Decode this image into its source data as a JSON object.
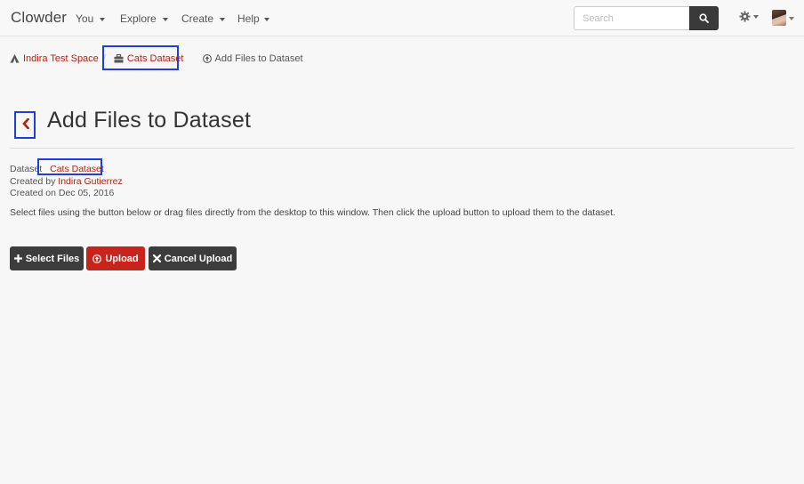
{
  "navbar": {
    "brand": "Clowder",
    "menus": [
      {
        "label": "You"
      },
      {
        "label": "Explore"
      },
      {
        "label": "Create"
      },
      {
        "label": "Help"
      }
    ],
    "search_placeholder": "Search"
  },
  "breadcrumb": {
    "space": "Indira Test Space",
    "dataset": "Cats Dataset",
    "current": "Add Files to Dataset"
  },
  "page": {
    "title": "Add Files to Dataset",
    "dataset_label": "Dataset",
    "dataset_name": "Cats Dataset",
    "created_by_label": "Created by",
    "creator": "Indira Gutierrez",
    "created_on": "Created on Dec 05, 2016",
    "instructions": "Select files using the button below or drag files directly from the desktop to this window. Then click the upload button to upload them to the dataset."
  },
  "buttons": {
    "select_files": "Select Files",
    "upload": "Upload",
    "cancel_upload": "Cancel Upload"
  },
  "colors": {
    "accent": "#b3200d",
    "highlight": "#1d3fe0",
    "upload": "#c9241c",
    "dark_button": "#3c3c3c"
  },
  "icons": {
    "breadcrumb_space": "users-icon",
    "breadcrumb_dataset": "briefcase-icon",
    "breadcrumb_current": "upload-circle-icon",
    "back": "chevron-left-icon",
    "search": "search-icon",
    "settings": "gear-icon"
  }
}
